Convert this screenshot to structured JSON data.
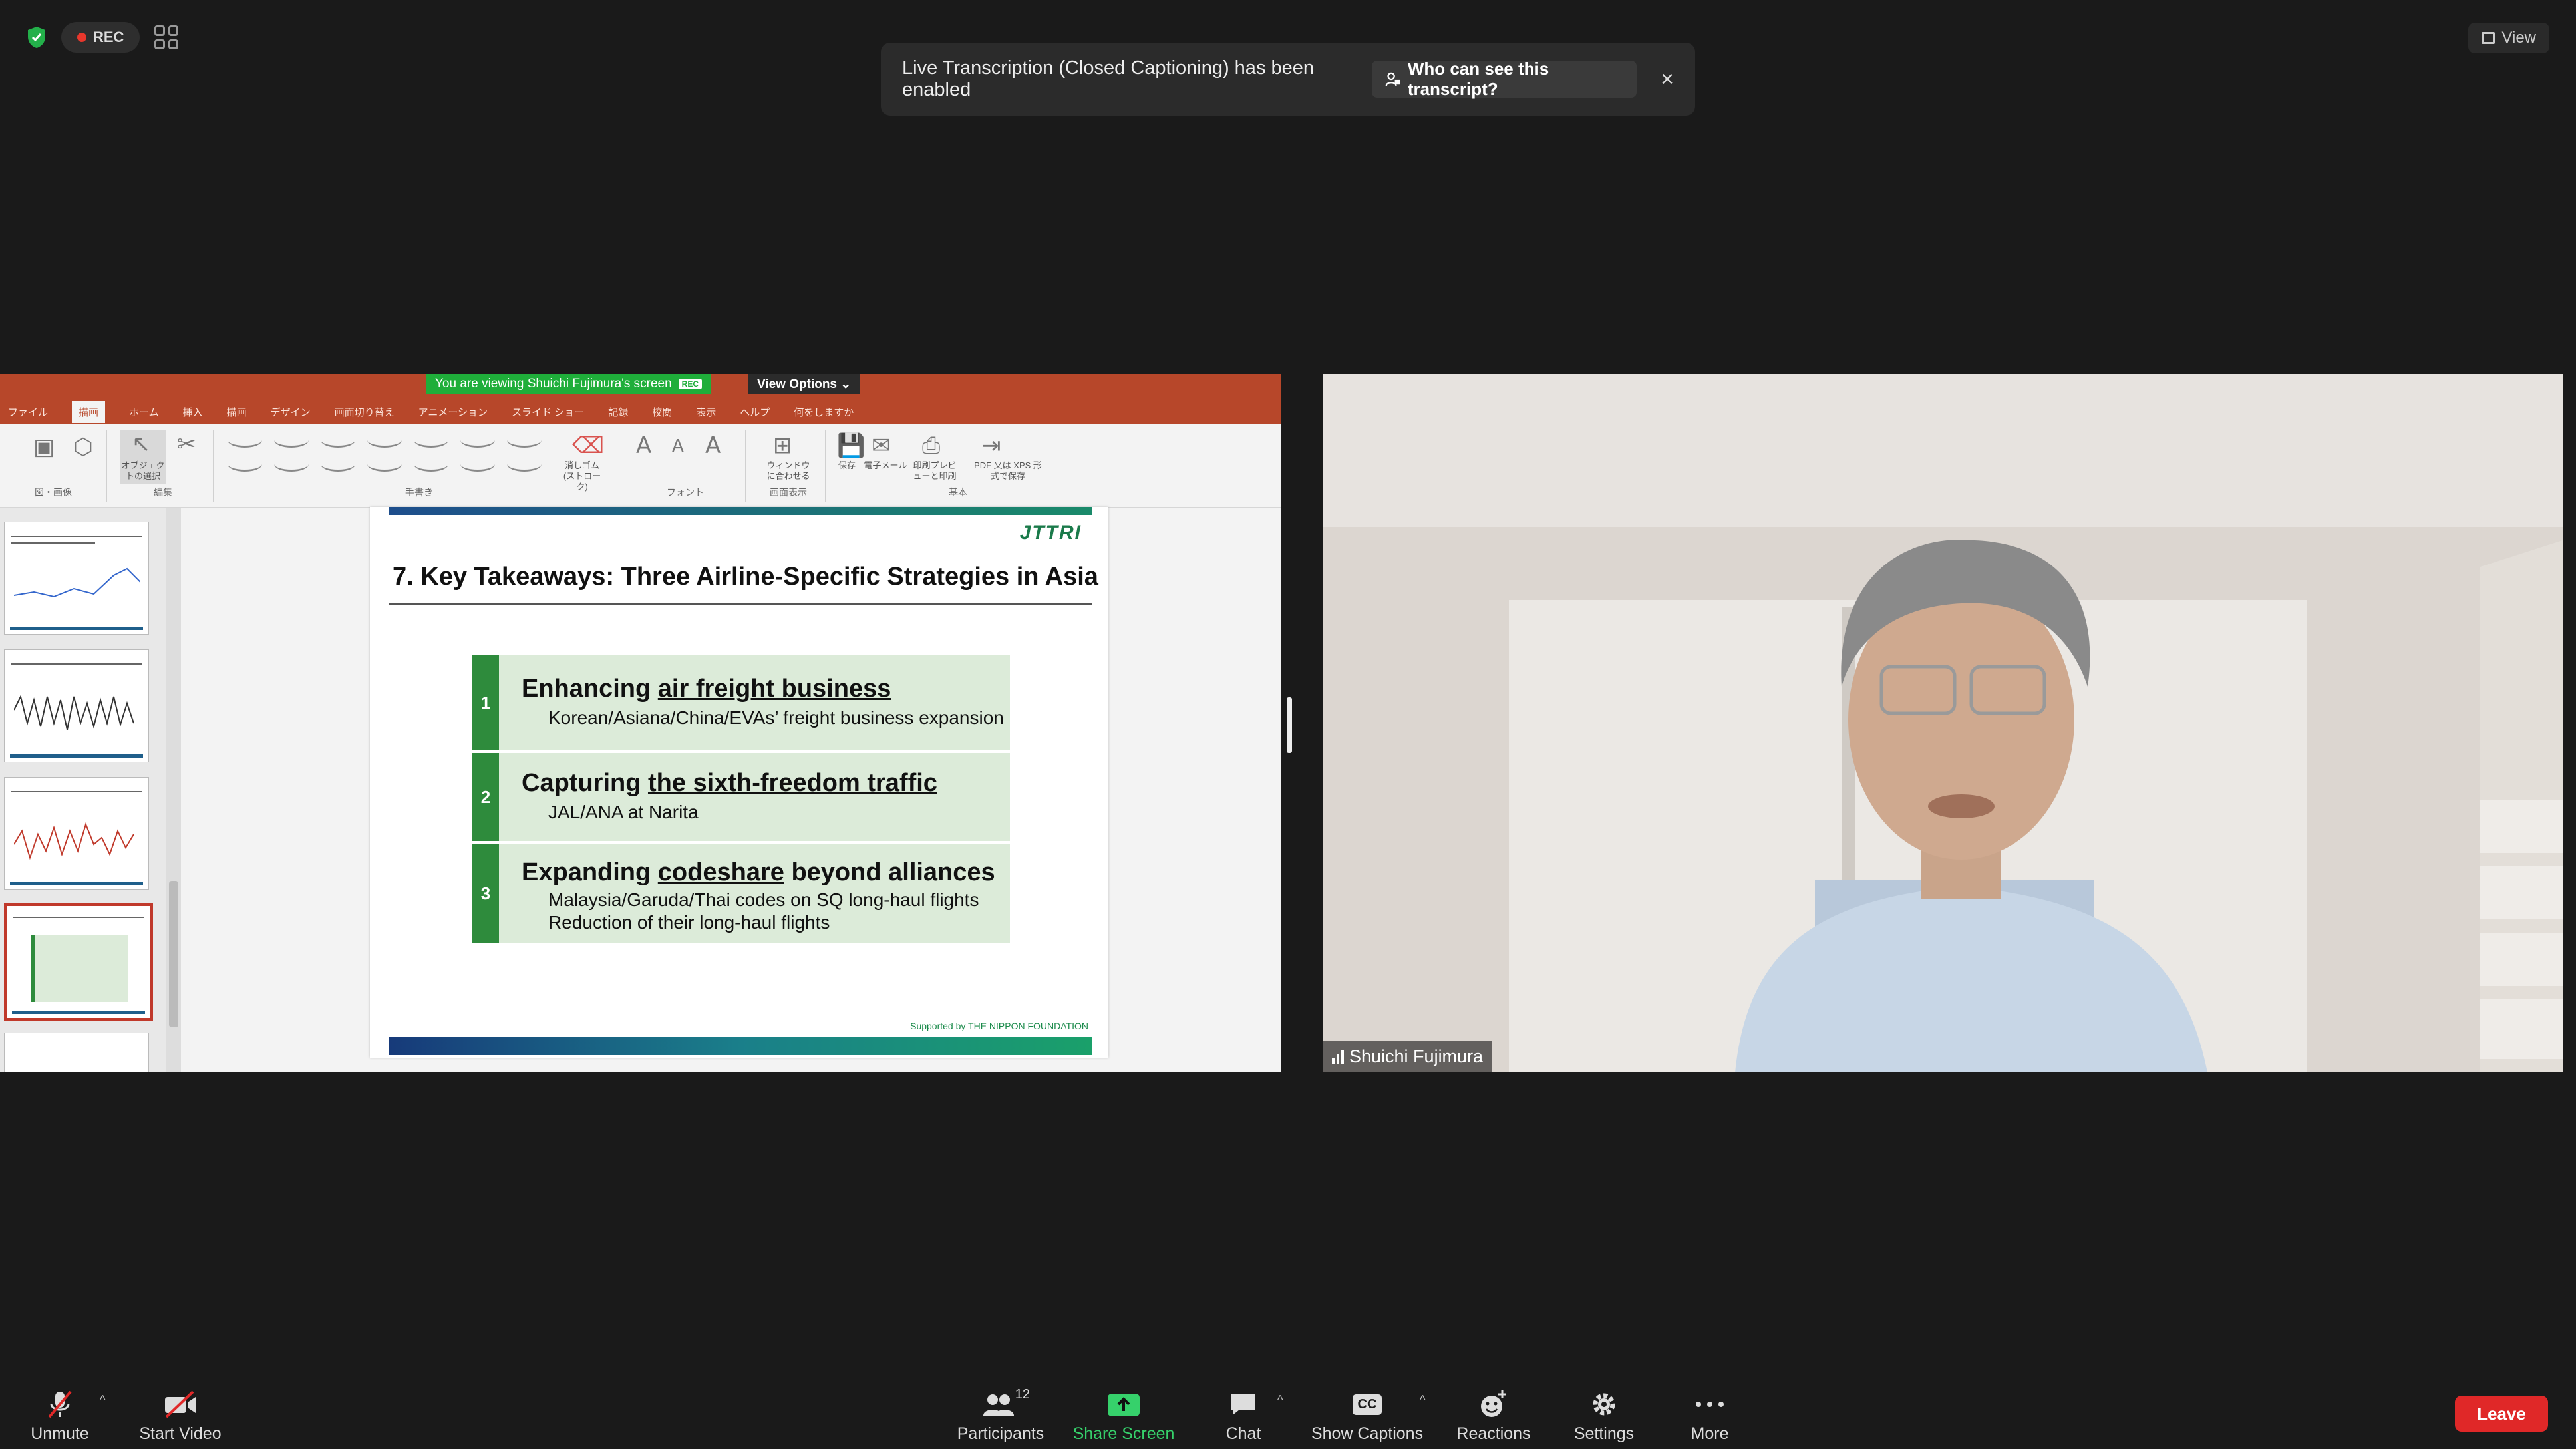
{
  "top": {
    "rec_label": "REC",
    "view_label": "View"
  },
  "notice": {
    "text": "Live Transcription (Closed Captioning) has been enabled",
    "button": "Who can see this transcript?",
    "close": "×"
  },
  "share": {
    "viewing_text": "You are viewing Shuichi Fujimura's screen",
    "viewing_rec": "REC",
    "view_options": "View Options ⌄",
    "ribbon_tabs": [
      "ファイル",
      "描画",
      "ホーム",
      "挿入",
      "描画",
      "デザイン",
      "画面切り替え",
      "アニメーション",
      "スライド ショー",
      "記録",
      "校閲",
      "表示",
      "ヘルプ",
      "何をしますか"
    ],
    "ribbon_groups": [
      "図・画像",
      "編集",
      "手書き",
      "フォント",
      "画面表示",
      "基本"
    ],
    "ribbon_items": {
      "select": "オブジェクトの選択",
      "eraser": "消しゴム (ストローク)",
      "fit": "ウィンドウに合わせる",
      "save": "保存",
      "email": "電子メール",
      "print": "印刷プレビューと印刷",
      "pdf": "PDF 又は XPS 形式で保存"
    }
  },
  "slide": {
    "logo": "JTTRI",
    "title": "7. Key Takeaways: Three Airline-Specific Strategies in Asia",
    "items": [
      {
        "num": "1",
        "head_pre": "Enhancing ",
        "head_u": "air freight business",
        "head_post": "",
        "subs": [
          "Korean/Asiana/China/EVAs’ freight business expansion"
        ]
      },
      {
        "num": "2",
        "head_pre": "Capturing ",
        "head_u": "the sixth-freedom traffic",
        "head_post": "",
        "subs": [
          "JAL/ANA at Narita"
        ]
      },
      {
        "num": "3",
        "head_pre": "Expanding ",
        "head_u": "codeshare",
        "head_post": " beyond alliances",
        "subs": [
          "Malaysia/Garuda/Thai codes on SQ long-haul flights",
          "Reduction of their long-haul flights"
        ]
      }
    ],
    "support": "Supported by THE NIPPON FOUNDATION"
  },
  "video": {
    "name": "Shuichi Fujimura"
  },
  "toolbar": {
    "unmute": "Unmute",
    "start_video": "Start Video",
    "participants": "Participants",
    "participants_count": "12",
    "share_screen": "Share Screen",
    "chat": "Chat",
    "show_captions": "Show Captions",
    "reactions": "Reactions",
    "settings": "Settings",
    "more": "More",
    "leave": "Leave"
  },
  "colors": {
    "ppt_red": "#b7472a",
    "share_green": "#36d16b",
    "leave_red": "#e02828",
    "slide_green": "#2e8b3c"
  }
}
